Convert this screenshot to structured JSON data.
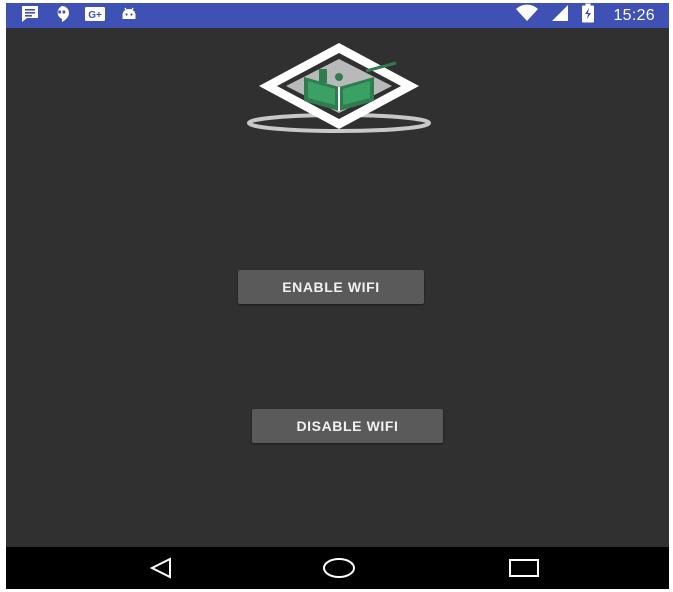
{
  "status_bar": {
    "time": "15:26",
    "notification_icons": [
      "message-icon",
      "hangouts-icon",
      "google-plus-icon",
      "android-icon"
    ],
    "g_plus_text": "G+",
    "right_icons": [
      "wifi-icon",
      "signal-icon",
      "battery-charging-icon"
    ],
    "bar_color": "#3f51b5"
  },
  "app": {
    "background_color": "#303030",
    "logo_icon": "book-logo-icon"
  },
  "buttons": {
    "enable_label": "ENABLE WIFI",
    "disable_label": "DISABLE WIFI",
    "button_color": "#5a5a5a"
  },
  "nav_bar": {
    "icons": [
      "back-icon",
      "home-icon",
      "recents-icon"
    ]
  }
}
